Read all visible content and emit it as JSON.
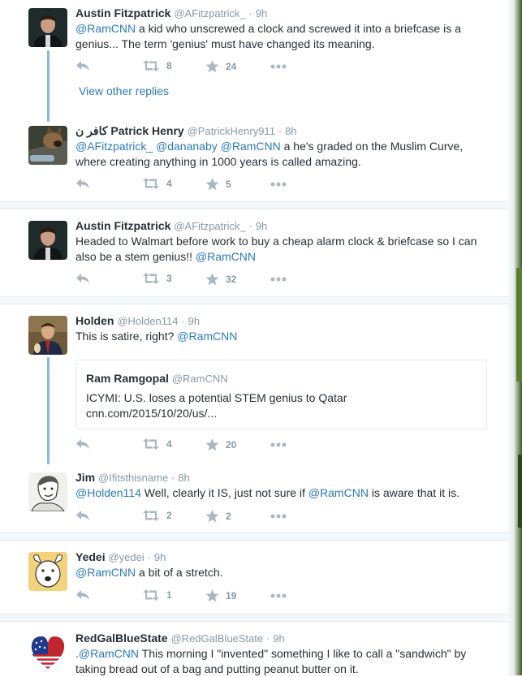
{
  "tweets": [
    {
      "name": "Austin Fitzpatrick",
      "handle": "@AFitzpatrick_",
      "time": "9h",
      "text_parts": [
        {
          "t": "@RamCNN",
          "mention": true
        },
        {
          "t": " a kid who unscrewed a clock and screwed it into a briefcase is a genius... The term 'genius' must have changed its meaning.",
          "mention": false
        }
      ],
      "retweets": "8",
      "likes": "24"
    },
    {
      "name": "Patrick Henry",
      "name_suffix": "كافر ن",
      "handle": "@PatrickHenry911",
      "time": "8h",
      "text_parts": [
        {
          "t": "@AFitzpatrick_ @dananaby @RamCNN",
          "mention": true
        },
        {
          "t": " a he's graded on the Muslim Curve, where creating anything in 1000 years is called amazing.",
          "mention": false
        }
      ],
      "retweets": "4",
      "likes": "5"
    },
    {
      "name": "Austin Fitzpatrick",
      "handle": "@AFitzpatrick_",
      "time": "9h",
      "text_parts": [
        {
          "t": "Headed to Walmart before work to buy a cheap alarm clock & briefcase so I can also be a stem genius!! ",
          "mention": false
        },
        {
          "t": "@RamCNN",
          "mention": true
        }
      ],
      "retweets": "3",
      "likes": "32"
    },
    {
      "name": "Holden",
      "handle": "@Holden114",
      "time": "9h",
      "text_parts": [
        {
          "t": "This is satire, right? ",
          "mention": false
        },
        {
          "t": "@RamCNN",
          "mention": true
        }
      ],
      "quote": {
        "name": "Ram Ramgopal",
        "handle": "@RamCNN",
        "line1": "ICYMI: U.S. loses a potential STEM genius to Qatar",
        "line2": "cnn.com/2015/10/20/us/..."
      },
      "retweets": "4",
      "likes": "20"
    },
    {
      "name": "Jim",
      "handle": "@Ifitsthisname",
      "time": "8h",
      "text_parts": [
        {
          "t": "@Holden114",
          "mention": true
        },
        {
          "t": " Well, clearly it IS, just not sure if ",
          "mention": false
        },
        {
          "t": "@RamCNN",
          "mention": true
        },
        {
          "t": " is aware that it is.",
          "mention": false
        }
      ],
      "retweets": "2",
      "likes": "2"
    },
    {
      "name": "Yedei",
      "handle": "@yedei",
      "time": "9h",
      "text_parts": [
        {
          "t": "@RamCNN",
          "mention": true
        },
        {
          "t": " a bit of a stretch.",
          "mention": false
        }
      ],
      "retweets": "1",
      "likes": "19"
    },
    {
      "name": "RedGalBlueState",
      "handle": "@RedGalBlueState",
      "time": "9h",
      "text_parts": [
        {
          "t": ".",
          "mention": false
        },
        {
          "t": "@RamCNN",
          "mention": true
        },
        {
          "t": " This morning I \"invented\" something I like to call a \"sandwich\" by taking bread out of a bag and putting peanut butter on it.",
          "mention": false
        }
      ]
    }
  ],
  "view_other_replies": "View other replies",
  "dot": "·",
  "icons": {
    "reply": "reply-icon",
    "retweet": "retweet-icon",
    "like": "star-icon",
    "more": "more-icon"
  },
  "colors": {
    "link": "#2b7bb9",
    "thread_line": "#8bb6e0",
    "action_gray": "#aab8c2"
  }
}
